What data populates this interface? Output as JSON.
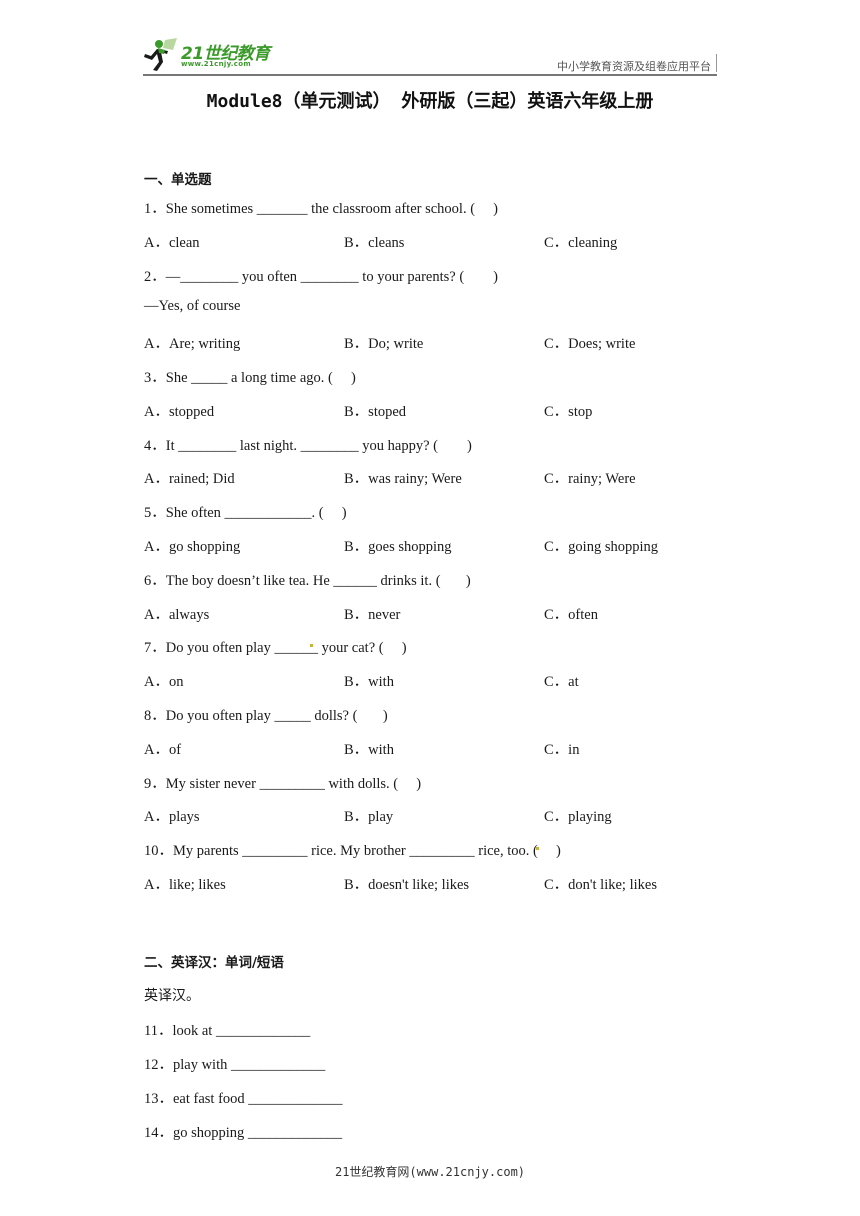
{
  "header": {
    "logo_name": "21世纪教育",
    "logo_url": "www.21cnjy.com",
    "platform": "中小学教育资源及组卷应用平台"
  },
  "title": "Module8（单元测试） 外研版（三起）英语六年级上册",
  "sections": [
    {
      "heading": "一、单选题",
      "questions": [
        {
          "stem": "1．She sometimes _______ the classroom after school. (     )",
          "options": [
            "A．clean",
            "B．cleans",
            "C．cleaning"
          ]
        },
        {
          "stem": "2．—________ you often ________ to your parents? (        )",
          "extra": "—Yes, of course",
          "options": [
            "A．Are; writing",
            "B．Do; write",
            "C．Does; write"
          ]
        },
        {
          "stem": "3．She _____ a long time ago. (     )",
          "options": [
            "A．stopped",
            "B．stoped",
            "C．stop"
          ]
        },
        {
          "stem": "4．It ________ last night. ________ you happy? (        )",
          "options": [
            "A．rained; Did",
            "B．was rainy; Were",
            "C．rainy; Were"
          ]
        },
        {
          "stem": "5．She often ____________. (     )",
          "options": [
            "A．go shopping",
            "B．goes shopping",
            "C．going shopping"
          ]
        },
        {
          "stem": "6．The boy doesn’t like tea. He ______ drinks it. (       )",
          "options": [
            "A．always",
            "B．never",
            "C．often"
          ]
        },
        {
          "stem": "7．Do you often play ______ your cat? (     )",
          "options": [
            "A．on",
            "B．with",
            "C．at"
          ]
        },
        {
          "stem": "8．Do you often play _____ dolls? (       )",
          "options": [
            "A．of",
            "B．with",
            "C．in"
          ]
        },
        {
          "stem": "9．My sister never _________ with dolls. (     )",
          "options": [
            "A．plays",
            "B．play",
            "C．playing"
          ]
        },
        {
          "stem": "10．My parents _________ rice. My brother _________ rice, too. (     )",
          "options": [
            "A．like; likes",
            "B．doesn't like; likes",
            "C．don't like; likes"
          ]
        }
      ]
    },
    {
      "heading": "二、英译汉：单词/短语",
      "instruction": "英译汉。",
      "items": [
        "11．look at _____________",
        "12．play with _____________",
        "13．eat fast food _____________",
        "14．go shopping _____________"
      ]
    }
  ],
  "footer": "21世纪教育网(www.21cnjy.com)"
}
